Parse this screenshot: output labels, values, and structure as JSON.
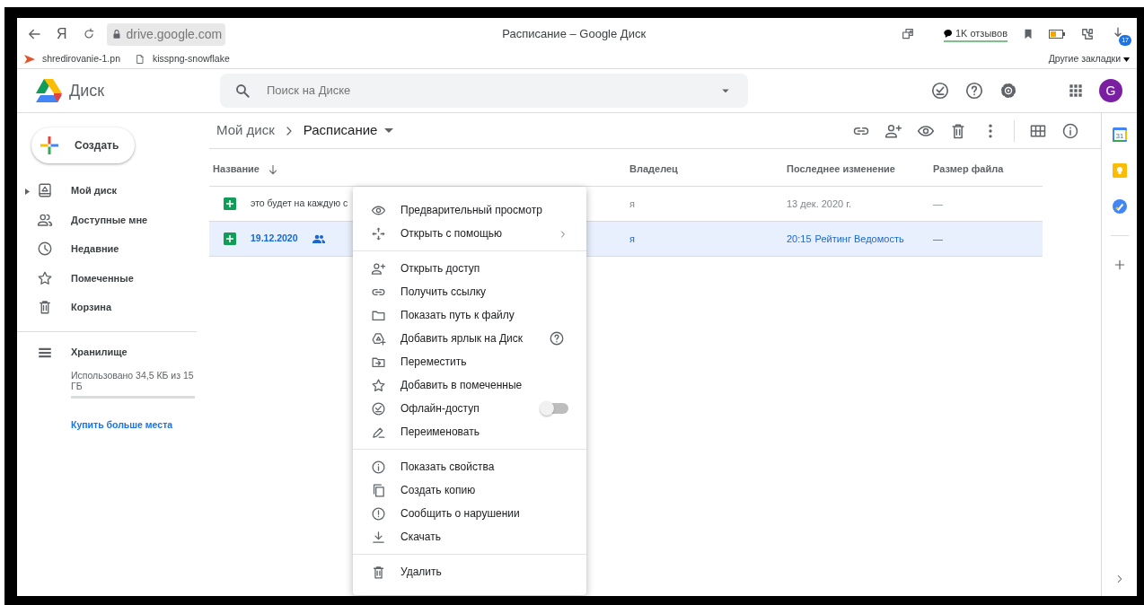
{
  "browser": {
    "yandex_glyph": "Я",
    "address": "drive.google.com",
    "title": "Расписание – Google Диск",
    "reviews": "1K отзывов",
    "downloads_badge": "17",
    "bookmarks": [
      {
        "label": "shredirovanie-1.pn",
        "kind": "arrow"
      },
      {
        "label": "kisspng-snowflake",
        "kind": "page"
      }
    ],
    "other_bookmarks": "Другие закладки"
  },
  "app": {
    "name": "Диск",
    "search": {
      "placeholder": "Поиск на Диске"
    },
    "avatar": "G"
  },
  "sidebar": {
    "create": "Создать",
    "items": [
      {
        "label": "Мой диск",
        "expandable": true
      },
      {
        "label": "Доступные мне",
        "expandable": false
      },
      {
        "label": "Недавние",
        "expandable": false
      },
      {
        "label": "Помеченные",
        "expandable": false
      },
      {
        "label": "Корзина",
        "expandable": false
      }
    ],
    "storage": {
      "label": "Хранилище",
      "usage": "Использовано 34,5 КБ из 15 ГБ",
      "level": 0,
      "buy": "Купить больше места"
    }
  },
  "breadcrumb": [
    "Мой диск",
    "Расписание"
  ],
  "table": {
    "columns": [
      "Название",
      "Владелец",
      "Последнее изменение",
      "Размер файла"
    ],
    "rows": [
      {
        "name": "это будет на каждую с",
        "shared": false,
        "owner": "я",
        "modified": "13 дек. 2020 г.",
        "size": "—",
        "selected": false
      },
      {
        "name": "19.12.2020",
        "shared": true,
        "owner": "я",
        "modified": "20:15",
        "modified_by": "Рейтинг Ведомость",
        "size": "—",
        "selected": true
      }
    ]
  },
  "context_menu": {
    "groups": [
      [
        {
          "label": "Предварительный просмотр",
          "kind": "item"
        },
        {
          "label": "Открыть с помощью",
          "kind": "submenu"
        }
      ],
      [
        {
          "label": "Открыть доступ",
          "kind": "item"
        },
        {
          "label": "Получить ссылку",
          "kind": "item"
        },
        {
          "label": "Показать путь к файлу",
          "kind": "item"
        },
        {
          "label": "Добавить ярлык на Диск",
          "kind": "help"
        },
        {
          "label": "Переместить",
          "kind": "item"
        },
        {
          "label": "Добавить в помеченные",
          "kind": "item"
        },
        {
          "label": "Офлайн-доступ",
          "kind": "toggle",
          "on": false
        },
        {
          "label": "Переименовать",
          "kind": "item"
        }
      ],
      [
        {
          "label": "Показать свойства",
          "kind": "item"
        },
        {
          "label": "Создать копию",
          "kind": "item"
        },
        {
          "label": "Сообщить о нарушении",
          "kind": "item"
        },
        {
          "label": "Скачать",
          "kind": "item"
        }
      ],
      [
        {
          "label": "Удалить",
          "kind": "item"
        }
      ]
    ]
  },
  "side_panel": {
    "calendar_day": "31"
  }
}
